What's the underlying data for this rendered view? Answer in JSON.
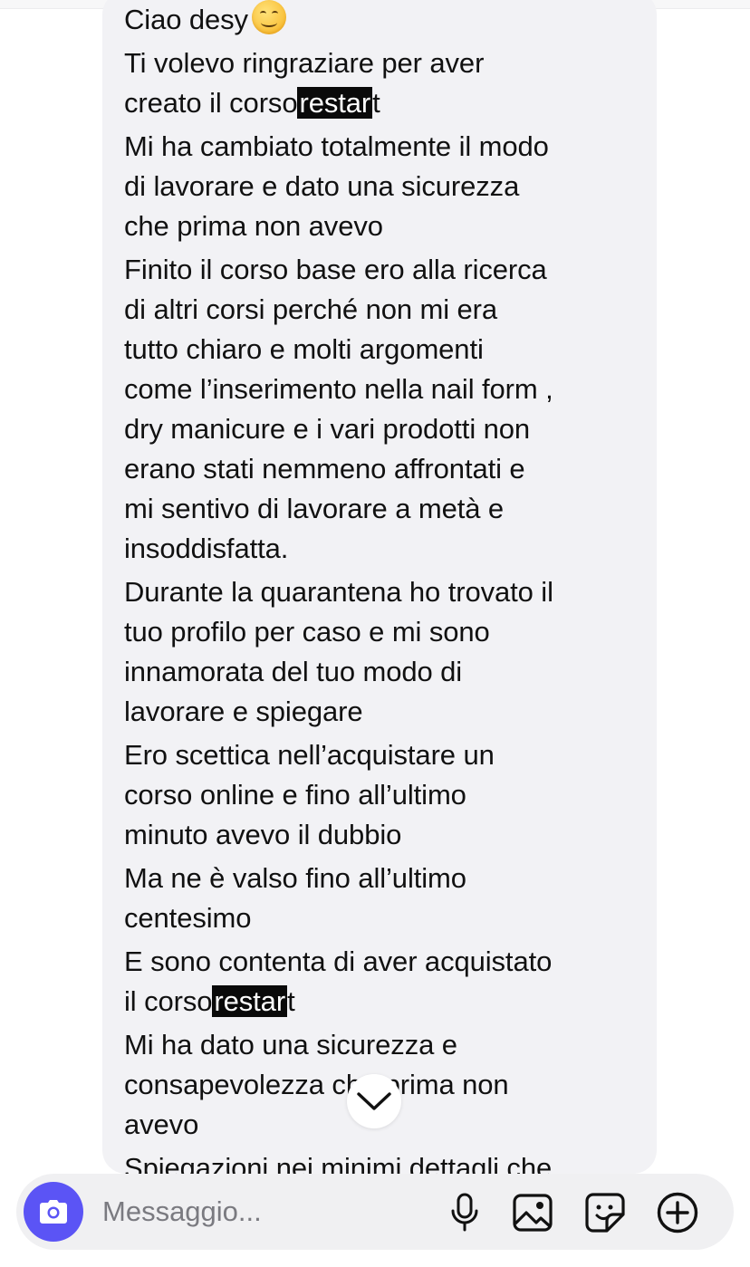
{
  "message": {
    "paragraphs": [
      {
        "lines": [
          [
            {
              "t": "Ciao desy"
            },
            {
              "emoji": "smiling-face"
            }
          ]
        ]
      },
      {
        "lines": [
          [
            {
              "t": "Ti volevo ringraziare per aver"
            }
          ],
          [
            {
              "t": "creato il corso"
            },
            {
              "t": "restar",
              "hl": true
            },
            {
              "t": "t"
            }
          ]
        ]
      },
      {
        "lines": [
          [
            {
              "t": "Mi ha cambiato totalmente il modo"
            }
          ],
          [
            {
              "t": "di lavorare e dato una sicurezza"
            }
          ],
          [
            {
              "t": "che prima non avevo"
            }
          ]
        ]
      },
      {
        "lines": [
          [
            {
              "t": "Finito il corso base ero alla ricerca"
            }
          ],
          [
            {
              "t": "di altri corsi perché non mi era"
            }
          ],
          [
            {
              "t": "tutto chiaro e molti argomenti"
            }
          ],
          [
            {
              "t": "come l’inserimento nella nail form ,"
            }
          ],
          [
            {
              "t": "dry manicure e i vari prodotti non"
            }
          ],
          [
            {
              "t": "erano stati nemmeno affrontati e"
            }
          ],
          [
            {
              "t": "mi sentivo di lavorare a metà e"
            }
          ],
          [
            {
              "t": "insoddisfatta."
            }
          ]
        ]
      },
      {
        "lines": [
          [
            {
              "t": "Durante la quarantena ho trovato il"
            }
          ],
          [
            {
              "t": "tuo profilo per caso e mi sono"
            }
          ],
          [
            {
              "t": "innamorata del tuo modo di"
            }
          ],
          [
            {
              "t": "lavorare e spiegare"
            }
          ]
        ]
      },
      {
        "lines": [
          [
            {
              "t": "Ero scettica nell’acquistare un"
            }
          ],
          [
            {
              "t": "corso online e fino all’ultimo"
            }
          ],
          [
            {
              "t": "minuto avevo il dubbio"
            }
          ]
        ]
      },
      {
        "lines": [
          [
            {
              "t": "Ma ne è valso fino all’ultimo"
            }
          ],
          [
            {
              "t": "centesimo"
            }
          ]
        ]
      },
      {
        "lines": [
          [
            {
              "t": "E sono contenta di aver acquistato"
            }
          ],
          [
            {
              "t": "il corso"
            },
            {
              "t": "restar",
              "hl": true
            },
            {
              "t": "t"
            }
          ]
        ]
      },
      {
        "lines": [
          [
            {
              "t": "Mi ha dato una sicurezza e"
            }
          ],
          [
            {
              "t": "consapevolezza che prima non"
            }
          ],
          [
            {
              "t": "avevo"
            }
          ]
        ]
      },
      {
        "lines": [
          [
            {
              "t": "Spiegazioni nei minimi dettagli che"
            }
          ]
        ]
      }
    ]
  },
  "composer": {
    "placeholder": "Messaggio..."
  },
  "colors": {
    "accent": "#5b54f5",
    "bubble": "#f2f2f5",
    "composer_bg": "#f0f0f2",
    "highlight": "#0a0a0a"
  },
  "icons": {
    "camera": "camera-icon",
    "scroll": "chevron-down-icon",
    "mic": "microphone-icon",
    "gallery": "image-icon",
    "sticker": "sticker-icon",
    "add": "plus-circle-icon"
  }
}
